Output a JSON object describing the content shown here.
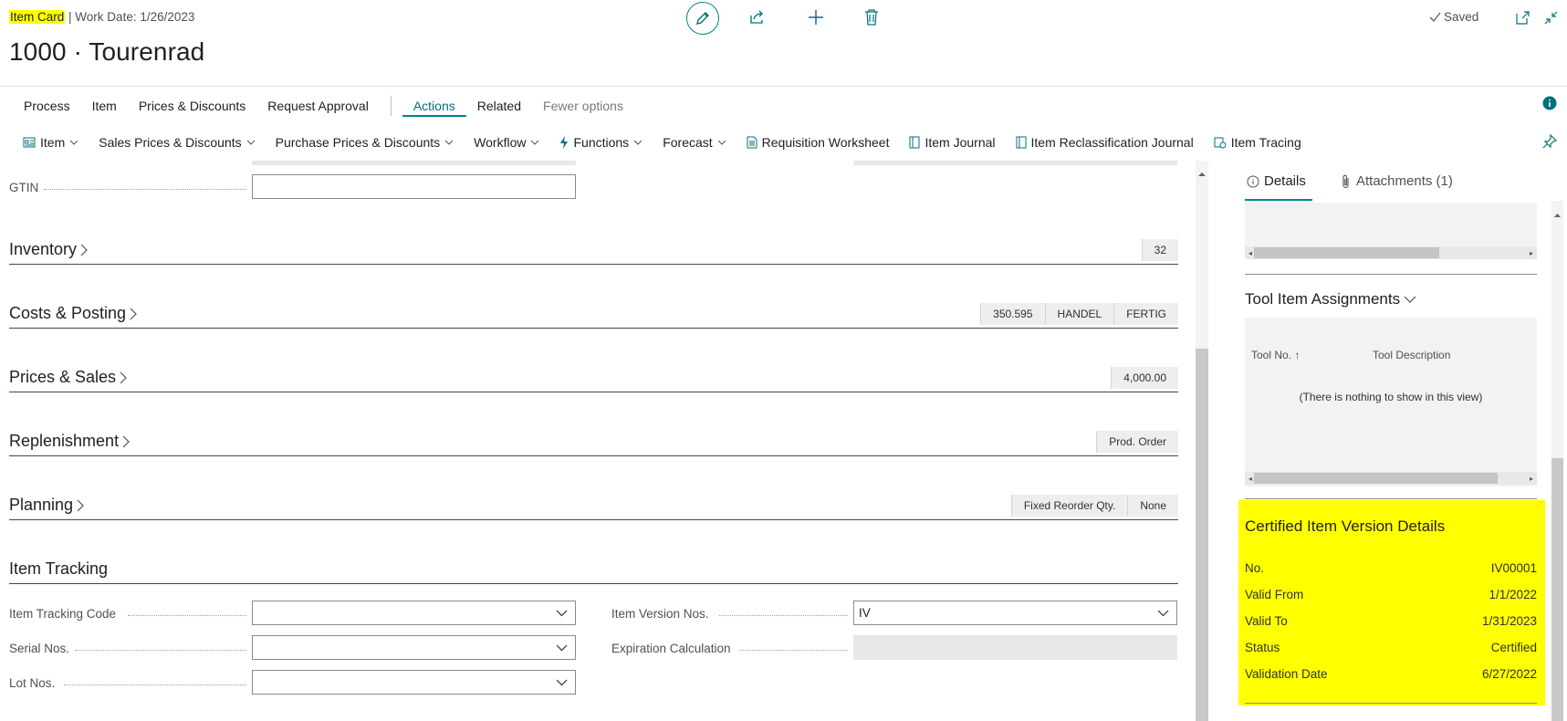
{
  "header": {
    "page_type": "Item Card",
    "work_date": "| Work Date: 1/26/2023",
    "title": "1000 · Tourenrad",
    "saved_label": "Saved"
  },
  "colors": {
    "accent": "#008489",
    "highlight": "#ffff00",
    "section_line": "#3a4b5c"
  },
  "icons": [
    "edit-icon",
    "share-icon",
    "add-icon",
    "delete-icon",
    "checkmark-icon",
    "open-new-window-icon",
    "collapse-icon",
    "info-icon",
    "pin-icon"
  ],
  "menu_primary": {
    "process": "Process",
    "item": "Item",
    "prices_discounts": "Prices & Discounts",
    "request_approval": "Request Approval",
    "actions": "Actions",
    "related": "Related",
    "fewer_options": "Fewer options"
  },
  "menu_actions": {
    "item": "Item",
    "sales_prices": "Sales Prices & Discounts",
    "purchase_prices": "Purchase Prices & Discounts",
    "workflow": "Workflow",
    "functions": "Functions",
    "forecast": "Forecast",
    "requisition_worksheet": "Requisition Worksheet",
    "item_journal": "Item Journal",
    "item_reclass_journal": "Item Reclassification Journal",
    "item_tracing": "Item Tracing"
  },
  "main": {
    "gtin_label": "GTIN",
    "gtin_value": "",
    "sections": {
      "inventory": {
        "title": "Inventory",
        "badges": [
          "32"
        ]
      },
      "costs": {
        "title": "Costs & Posting",
        "badges": [
          "350.595",
          "HANDEL",
          "FERTIG"
        ]
      },
      "prices": {
        "title": "Prices & Sales",
        "badges": [
          "4,000.00"
        ]
      },
      "replenishment": {
        "title": "Replenishment",
        "badges": [
          "Prod. Order"
        ]
      },
      "planning": {
        "title": "Planning",
        "badges": [
          "Fixed Reorder Qty.",
          "None"
        ]
      },
      "item_tracking": {
        "title": "Item Tracking"
      }
    },
    "tracking": {
      "item_tracking_code_label": "Item Tracking Code",
      "item_tracking_code_value": "",
      "serial_nos_label": "Serial Nos.",
      "serial_nos_value": "",
      "lot_nos_label": "Lot Nos.",
      "lot_nos_value": "",
      "item_version_nos_label": "Item Version Nos.",
      "item_version_nos_value": "IV",
      "expiration_calc_label": "Expiration Calculation",
      "expiration_calc_value": ""
    }
  },
  "factbox": {
    "tab_details": "Details",
    "tab_attachments": "Attachments (1)",
    "tool_assignments_title": "Tool Item Assignments",
    "tool_no_header": "Tool No. ↑",
    "tool_desc_header": "Tool Description",
    "empty_text": "(There is nothing to show in this view)",
    "certified": {
      "title": "Certified Item Version Details",
      "rows": [
        {
          "label": "No.",
          "value": "IV00001"
        },
        {
          "label": "Valid From",
          "value": "1/1/2022"
        },
        {
          "label": "Valid To",
          "value": "1/31/2023"
        },
        {
          "label": "Status",
          "value": "Certified"
        },
        {
          "label": "Validation Date",
          "value": "6/27/2022"
        }
      ]
    }
  }
}
